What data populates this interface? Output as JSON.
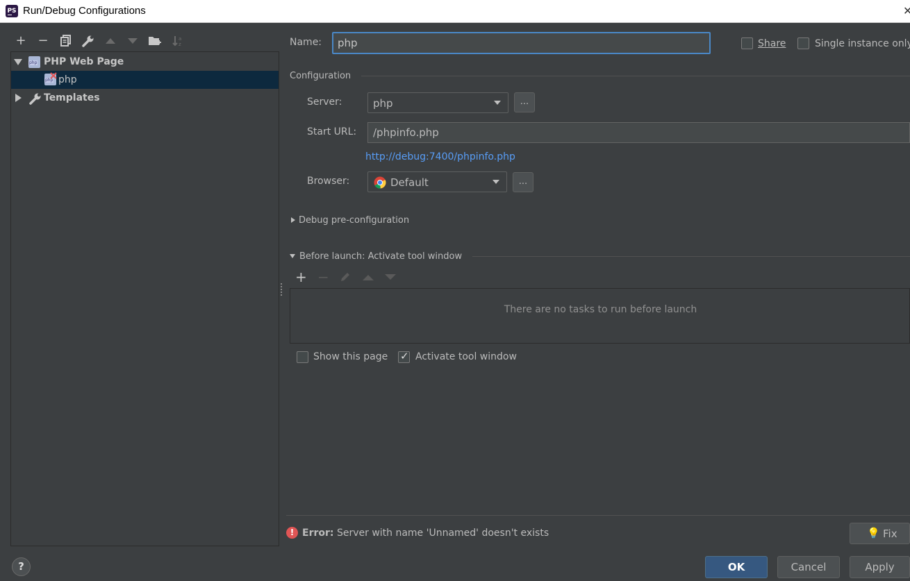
{
  "window": {
    "title": "Run/Debug Configurations",
    "app_icon_text": "PS"
  },
  "toolbar": {
    "icons": [
      "add-icon",
      "remove-icon",
      "copy-icon",
      "wrench-icon",
      "move-up-icon",
      "move-down-icon",
      "new-folder-icon",
      "sort-icon"
    ]
  },
  "tree": {
    "items": [
      {
        "label": "PHP Web Page",
        "expanded": true
      },
      {
        "label": "php",
        "selected": true
      },
      {
        "label": "Templates",
        "expanded": false
      }
    ]
  },
  "form": {
    "name_label": "Name:",
    "name_value": "php",
    "share_label": "Share",
    "single_instance_label": "Single instance only",
    "configuration_header": "Configuration",
    "server_label": "Server:",
    "server_value": "php",
    "start_url_label": "Start URL:",
    "start_url_value": "/phpinfo.php",
    "resolved_url": "http://debug:7400/phpinfo.php",
    "browser_label": "Browser:",
    "browser_value": "Default",
    "ellipsis": "...",
    "debug_preconfig_label": "Debug pre-configuration",
    "before_launch_label": "Before launch: Activate tool window",
    "no_tasks_text": "There are no tasks to run before launch",
    "show_page_label": "Show this page",
    "show_page_checked": false,
    "activate_tool_label": "Activate tool window",
    "activate_tool_checked": true
  },
  "error": {
    "prefix": "Error:",
    "message": "Server with name 'Unnamed' doesn't exists",
    "fix_label": "Fix"
  },
  "buttons": {
    "ok": "OK",
    "cancel": "Cancel",
    "apply": "Apply",
    "help": "?"
  },
  "colors": {
    "background": "#3c3f41",
    "link": "#589df6",
    "selection": "#0d293e",
    "error": "#e05555",
    "ok_button": "#365880"
  }
}
